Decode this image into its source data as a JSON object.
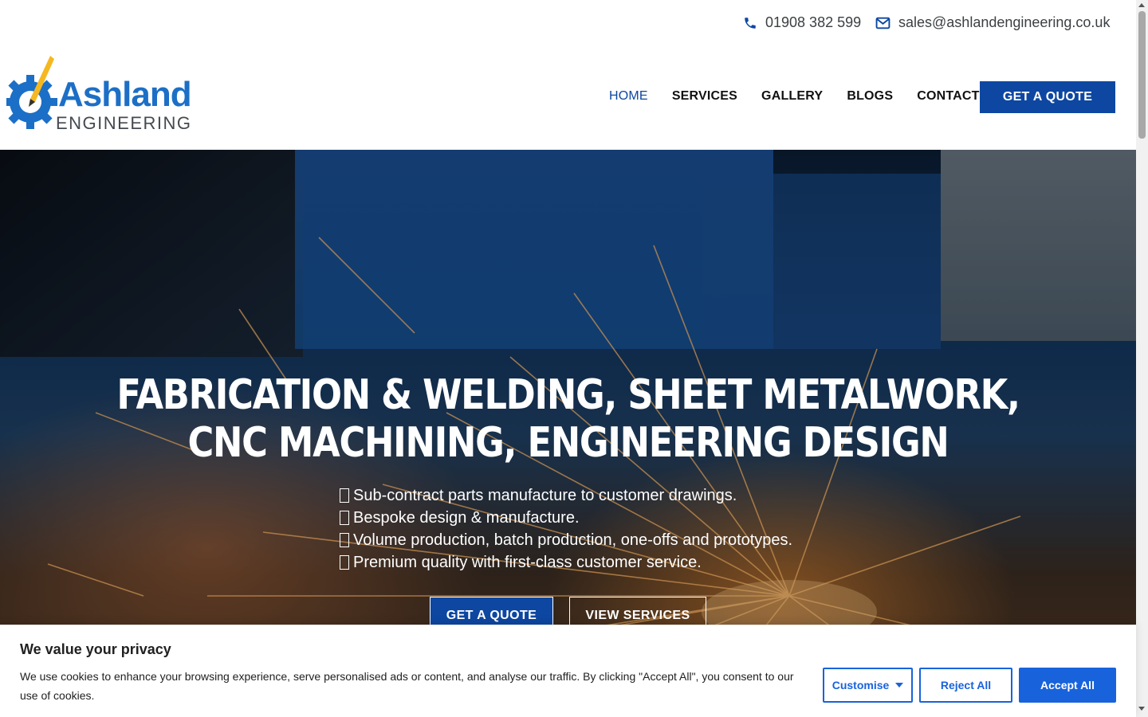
{
  "topbar": {
    "phone": "01908 382 599",
    "email": "sales@ashlandengineering.co.uk",
    "phone_icon": "phone-icon",
    "email_icon": "envelope-icon"
  },
  "logo": {
    "name": "Ashland",
    "subtitle": "ENGINEERING"
  },
  "nav": {
    "items": [
      {
        "label": "HOME",
        "active": true
      },
      {
        "label": "SERVICES",
        "active": false
      },
      {
        "label": "GALLERY",
        "active": false
      },
      {
        "label": "BLOGS",
        "active": false
      },
      {
        "label": "CONTACT",
        "active": false
      }
    ],
    "cta": "GET A QUOTE"
  },
  "hero": {
    "title_line1": "FABRICATION & WELDING, SHEET METALWORK,",
    "title_line2": "CNC MACHINING, ENGINEERING DESIGN",
    "points": [
      "Sub-contract parts manufacture to customer drawings.",
      "Bespoke design & manufacture.",
      "Volume production, batch production, one-offs and prototypes.",
      "Premium quality with first-class customer service."
    ],
    "quote_button": "GET A QUOTE",
    "services_button": "VIEW SERVICES"
  },
  "cookie": {
    "title": "We value your privacy",
    "text": "We use cookies to enhance your browsing experience, serve personalised ads or content, and analyse our traffic. By clicking \"Accept All\", you consent to our use of cookies.",
    "customise": "Customise",
    "reject": "Reject All",
    "accept": "Accept All"
  },
  "colors": {
    "brand_blue": "#0d47a1",
    "logo_blue": "#1c6fc6",
    "logo_yellow": "#f5b820",
    "cookie_blue": "#1863dc"
  }
}
